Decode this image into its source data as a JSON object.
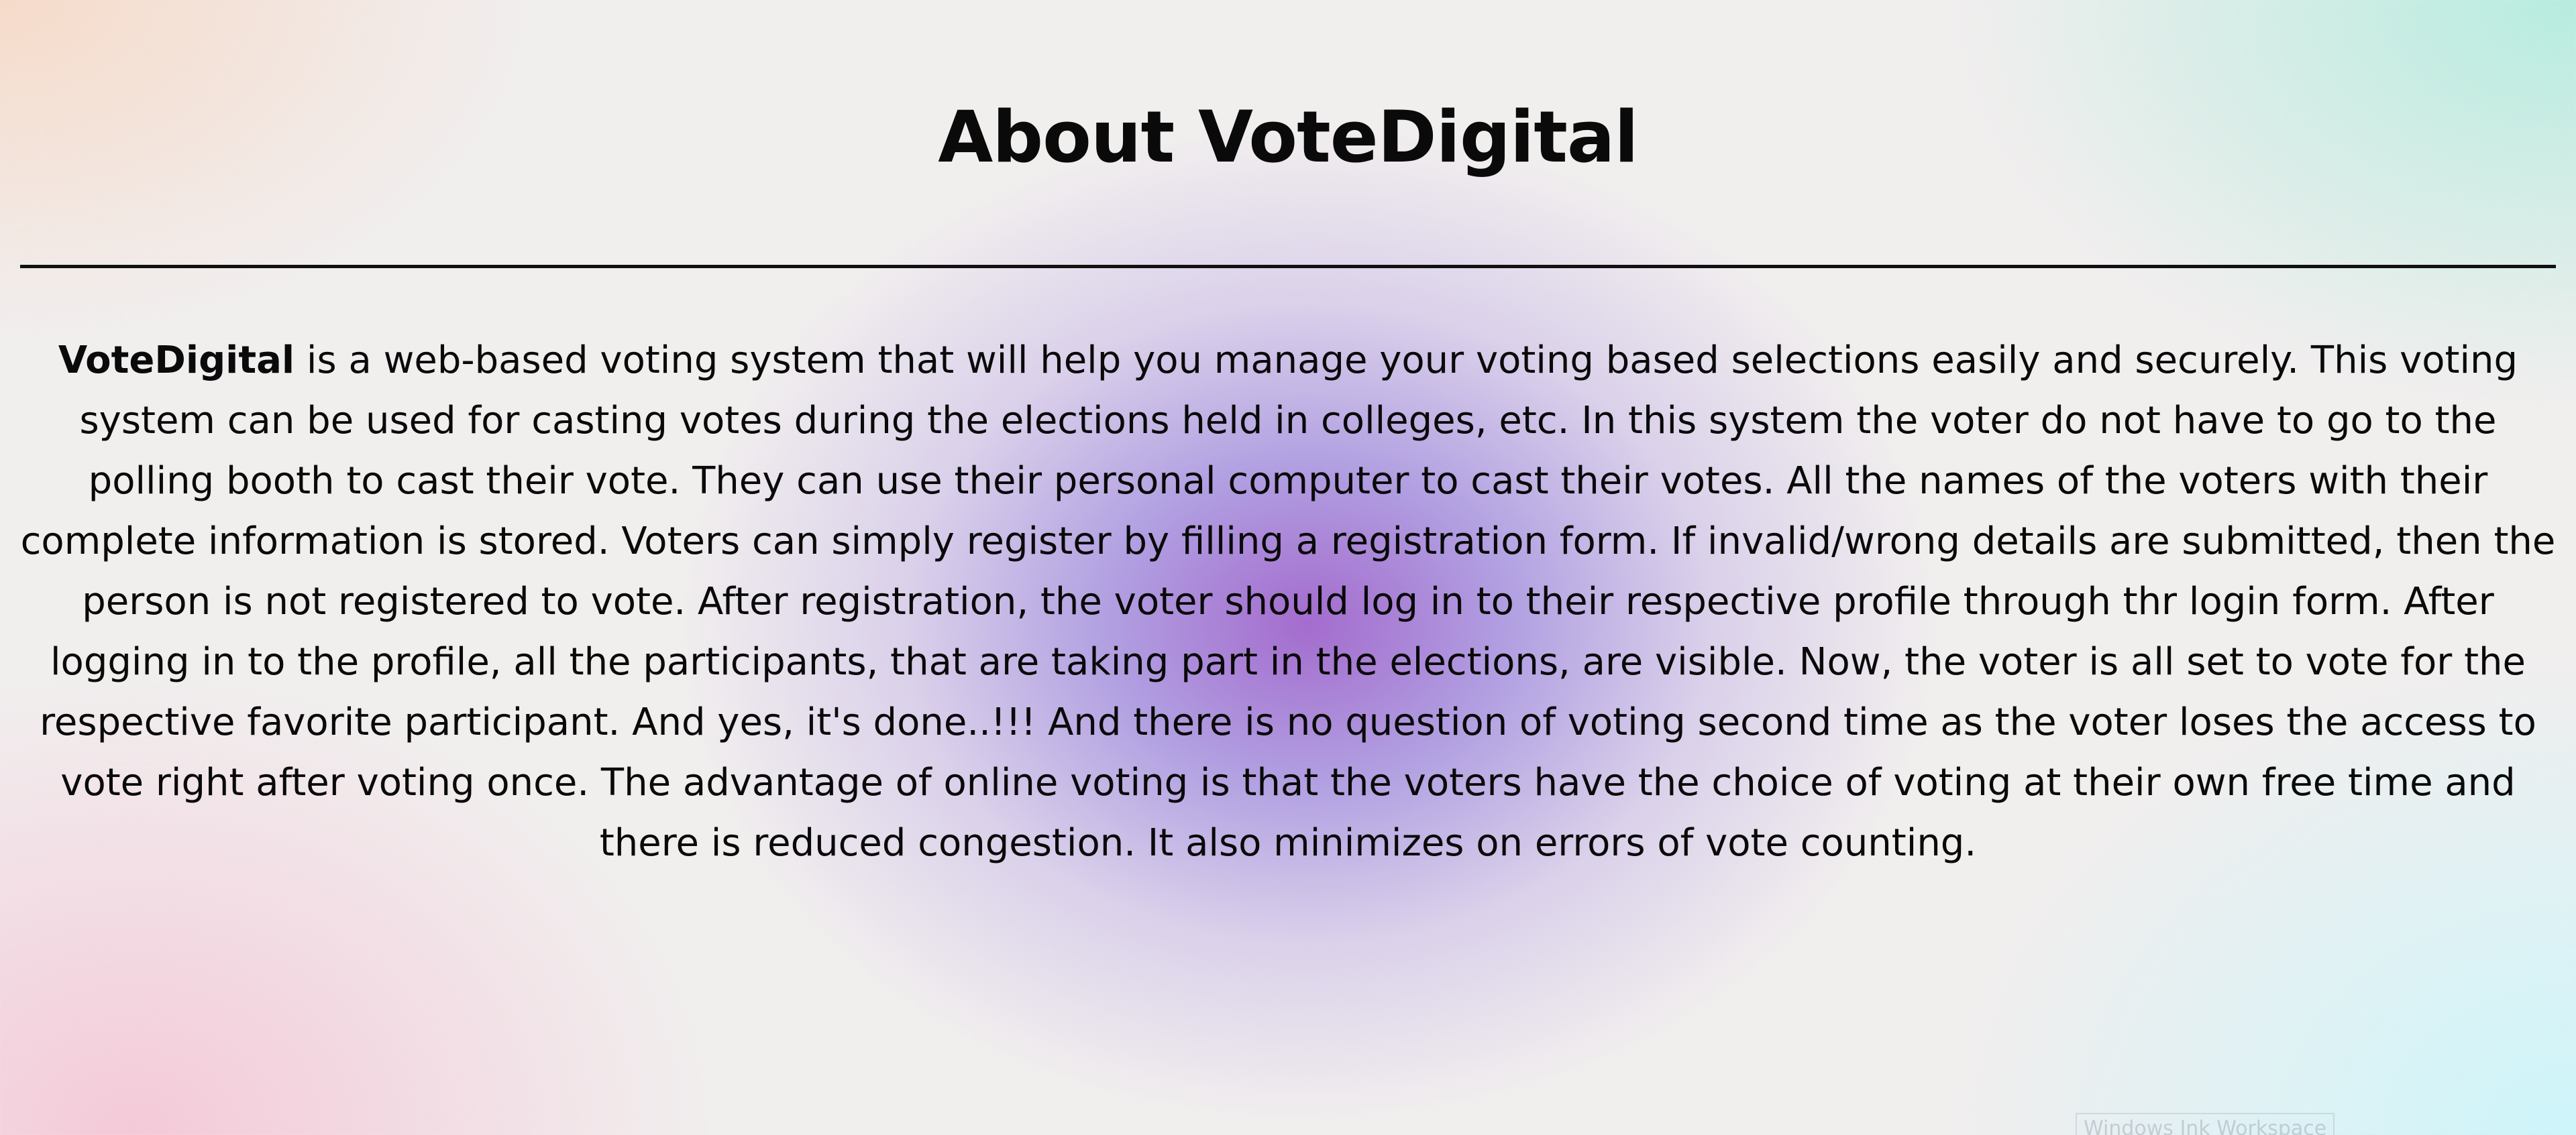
{
  "page": {
    "title": "About VoteDigital"
  },
  "about": {
    "brand": "VoteDigital",
    "body": " is a web-based voting system that will help you manage your voting based selections easily and securely. This voting system can be used for casting votes during the elections held in colleges, etc. In this system the voter do not have to go to the polling booth to cast their vote. They can use their personal computer to cast their votes. All the names of the voters with their complete information is stored. Voters can simply register by filling a registration form. If invalid/wrong details are submitted, then the person is not registered to vote. After registration, the voter should log in to their respective profile through thr login form. After logging in to the profile, all the participants, that are taking part in the elections, are visible. Now, the voter is all set to vote for the respective favorite participant. And yes, it's done..!!! And there is no question of voting second time as the voter loses the access to vote right after voting once. The advantage of online voting is that the voters have the choice of voting at their own free time and there is reduced congestion. It also minimizes on errors of vote counting."
  },
  "system": {
    "watermark": "Windows Ink Workspace"
  },
  "colors": {
    "text": "#0a0a0a",
    "divider": "#111111",
    "blob_purple": "#9655c8",
    "corner_peach": "#f6dac8",
    "corner_mint": "#b4ecde",
    "corner_pink": "#f4c8d7",
    "corner_cyan": "#cdf5fa"
  }
}
